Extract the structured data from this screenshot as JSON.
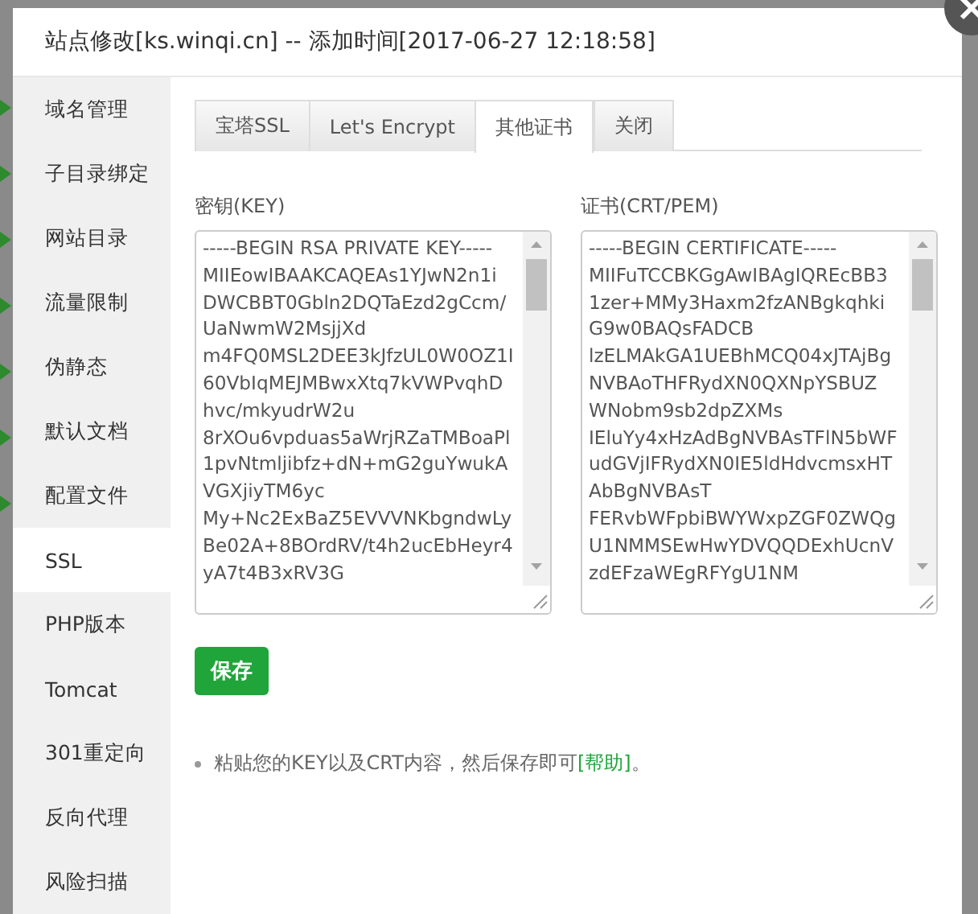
{
  "window": {
    "title": "站点修改[ks.winqi.cn] -- 添加时间[2017-06-27 12:18:58]"
  },
  "sidebar": {
    "items": [
      {
        "label": "域名管理",
        "selected": false
      },
      {
        "label": "子目录绑定",
        "selected": false
      },
      {
        "label": "网站目录",
        "selected": false
      },
      {
        "label": "流量限制",
        "selected": false
      },
      {
        "label": "伪静态",
        "selected": false
      },
      {
        "label": "默认文档",
        "selected": false
      },
      {
        "label": "配置文件",
        "selected": false
      },
      {
        "label": "SSL",
        "selected": true
      },
      {
        "label": "PHP版本",
        "selected": false
      },
      {
        "label": "Tomcat",
        "selected": false
      },
      {
        "label": "301重定向",
        "selected": false
      },
      {
        "label": "反向代理",
        "selected": false
      },
      {
        "label": "风险扫描",
        "selected": false
      }
    ]
  },
  "tabs": [
    {
      "label": "宝塔SSL",
      "selected": false
    },
    {
      "label": "Let's Encrypt",
      "selected": false
    },
    {
      "label": "其他证书",
      "selected": true
    },
    {
      "label": "关闭",
      "selected": false
    }
  ],
  "fields": [
    {
      "label": "密钥(KEY)",
      "value": [
        "-----BEGIN RSA PRIVATE KEY-----",
        "MIIEowIBAAKCAQEAs1YJwN2n1i",
        "DWCBBT0Gbln2DQTaEzd2gCcm/",
        "UaNwmW2MsjjXd",
        "m4FQ0MSL2DEE3kJfzUL0W0OZ1I",
        "60VbIqMEJMBwxXtq7kVWPvqhD",
        "hvc/mkyudrW2u",
        "8rXOu6vpduas5aWrjRZaTMBoaPl",
        "1pvNtmljibfz+dN+mG2guYwukA",
        "VGXjiyTM6yc",
        "My+Nc2ExBaZ5EVVVNKbgndwLy",
        "Be02A+8BOrdRV/t4h2ucEbHeyr4",
        "yA7t4B3xRV3G"
      ]
    },
    {
      "label": "证书(CRT/PEM)",
      "value": [
        "-----BEGIN CERTIFICATE-----",
        "MIIFuTCCBKGgAwIBAgIQREcBB3",
        "1zer+MMy3Haxm2fzANBgkqhki",
        "G9w0BAQsFADCB",
        "lzELMAkGA1UEBhMCQ04xJTAjBg",
        "NVBAoTHFRydXN0QXNpYSBUZ",
        "WNobm9sb2dpZXMs",
        "IEluYy4xHzAdBgNVBAsTFlN5bWF",
        "udGVjIFRydXN0IE5ldHdvcmsxHT",
        "AbBgNVBAsT",
        "FERvbWFpbiBWYWxpZGF0ZWQg",
        "U1NMMSEwHwYDVQQDExhUcnV",
        "zdEFzaWEgRFYgU1NM"
      ]
    }
  ],
  "save_button": "保存",
  "note": {
    "text": "粘贴您的KEY以及CRT内容，然后保存即可",
    "link": "[帮助]",
    "end": "。"
  }
}
